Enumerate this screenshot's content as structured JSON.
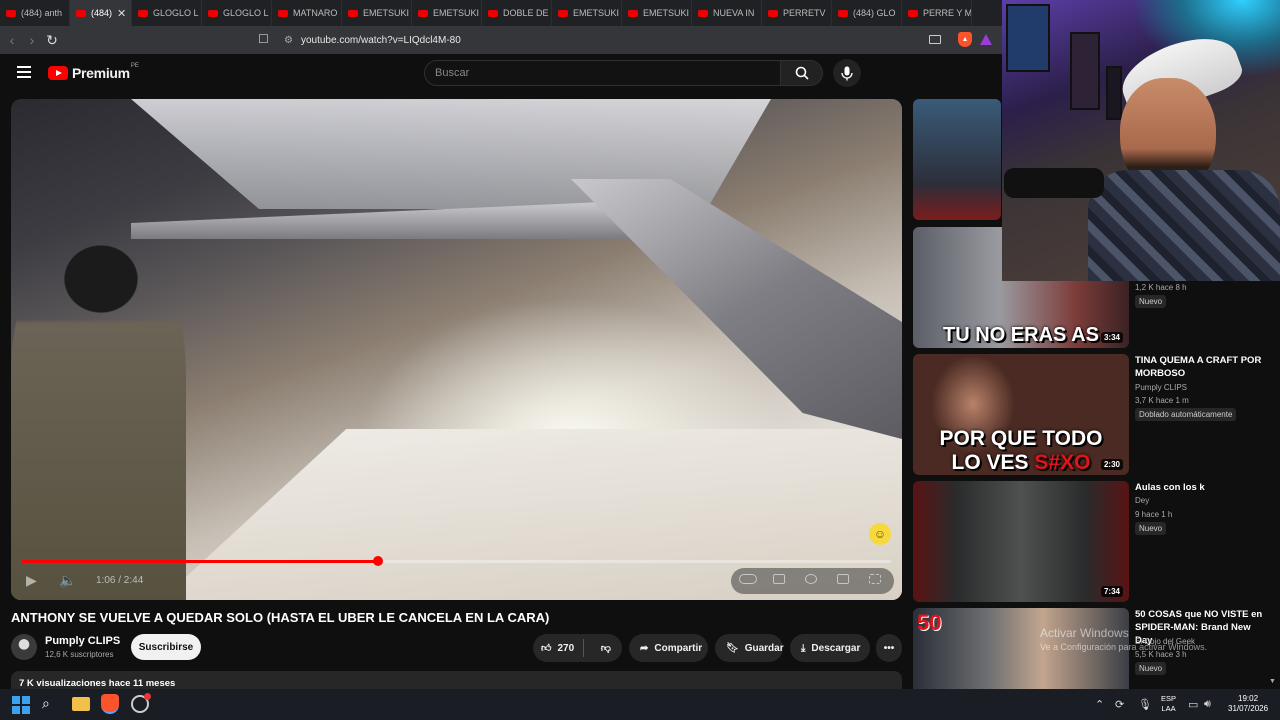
{
  "browser": {
    "tabs": [
      {
        "label": "(484) anth"
      },
      {
        "label": "(484)",
        "active": true
      },
      {
        "label": "GLOGLO L"
      },
      {
        "label": "GLOGLO L"
      },
      {
        "label": "MATNARO"
      },
      {
        "label": "EMETSUKI"
      },
      {
        "label": "EMETSUKI"
      },
      {
        "label": "DOBLE DE"
      },
      {
        "label": "EMETSUKI"
      },
      {
        "label": "EMETSUKI"
      },
      {
        "label": "NUEVA IN"
      },
      {
        "label": "PERRETV"
      },
      {
        "label": "(484) GLO"
      },
      {
        "label": "PERRE Y M"
      }
    ],
    "url": "youtube.com/watch?v=LIQdcl4M-80"
  },
  "youtube": {
    "logo_text": "Premium",
    "logo_region": "PE",
    "search_placeholder": "Buscar"
  },
  "player": {
    "time": "1:06 / 2:44",
    "progress": 0.41
  },
  "video": {
    "title": "ANTHONY SE VUELVE A QUEDAR SOLO (HASTA EL UBER LE CANCELA EN LA CARA)",
    "channel": "Pumply CLIPS",
    "subscribers": "12,6 K suscriptores",
    "subscribe_label": "Suscribirse",
    "likes": "270",
    "share_label": "Compartir",
    "save_label": "Guardar",
    "download_label": "Descargar",
    "views_date": "7 K visualizaciones  hace 11 meses"
  },
  "recommendations": [
    {
      "meta": "1,2 K  hace 8 h",
      "badge": "Nuevo"
    },
    {
      "duration": "3:34",
      "caption": "TU NO ERAS AS"
    },
    {
      "title": "TINA QUEMA A CRAFT POR MORBOSO",
      "channel": "Pumply CLIPS",
      "meta": "3,7 K  hace 1 m",
      "badge": "Doblado automáticamente",
      "duration": "2:30",
      "caption_line1": "POR QUE TODO",
      "caption_line2a": "LO VES ",
      "caption_line2b": "S#XO"
    },
    {
      "title": "Aulas con los k",
      "channel": "Dey",
      "meta": "9  hace 1 h",
      "badge": "Nuevo",
      "duration": "7:34"
    },
    {
      "title": "50 COSAS que NO VISTE en SPIDER-MAN: Brand New Day",
      "channel": "El Dojo del Geek",
      "meta": "5,5 K  hace 3 h",
      "badge": "Nuevo",
      "thumb_text": "50"
    }
  ],
  "watermark": {
    "line1": "Activar Windows",
    "line2": "Ve a Configuración para activar Windows."
  },
  "taskbar": {
    "lang_line1": "ESP",
    "lang_line2": "LAA",
    "time": "19:02",
    "date": "31/07/2026"
  },
  "colors": {
    "accent_red": "#ff0000",
    "background": "#0f0f0f",
    "brave": "#fb542b"
  }
}
